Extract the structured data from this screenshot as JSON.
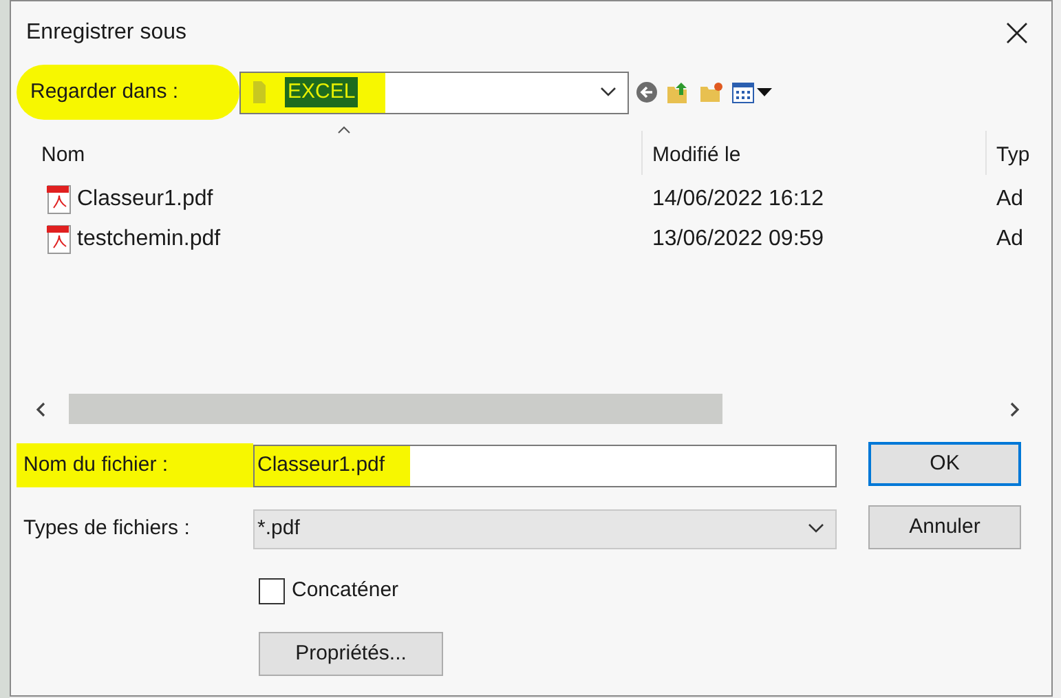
{
  "window": {
    "title": "Enregistrer sous"
  },
  "look_in": {
    "label": "Regarder dans :",
    "value": "EXCEL",
    "highlighted": true
  },
  "columns": [
    {
      "label": "Nom",
      "sorted": true
    },
    {
      "label": "Modifié le",
      "sorted": false
    },
    {
      "label": "Typ",
      "sorted": false
    }
  ],
  "files": [
    {
      "name": "Classeur1.pdf",
      "modified": "14/06/2022 16:12",
      "type": "Ad"
    },
    {
      "name": "testchemin.pdf",
      "modified": "13/06/2022 09:59",
      "type": "Ad"
    }
  ],
  "file_name": {
    "label": "Nom du fichier :",
    "value": "Classeur1.pdf",
    "highlighted": true
  },
  "file_type": {
    "label": "Types de fichiers :",
    "value": "*.pdf"
  },
  "concatenate": {
    "label": "Concaténer",
    "checked": false
  },
  "buttons": [
    {
      "label": "OK",
      "default": true
    },
    {
      "label": "Annuler",
      "default": false
    }
  ],
  "properties_button": {
    "label": "Propriétés..."
  }
}
